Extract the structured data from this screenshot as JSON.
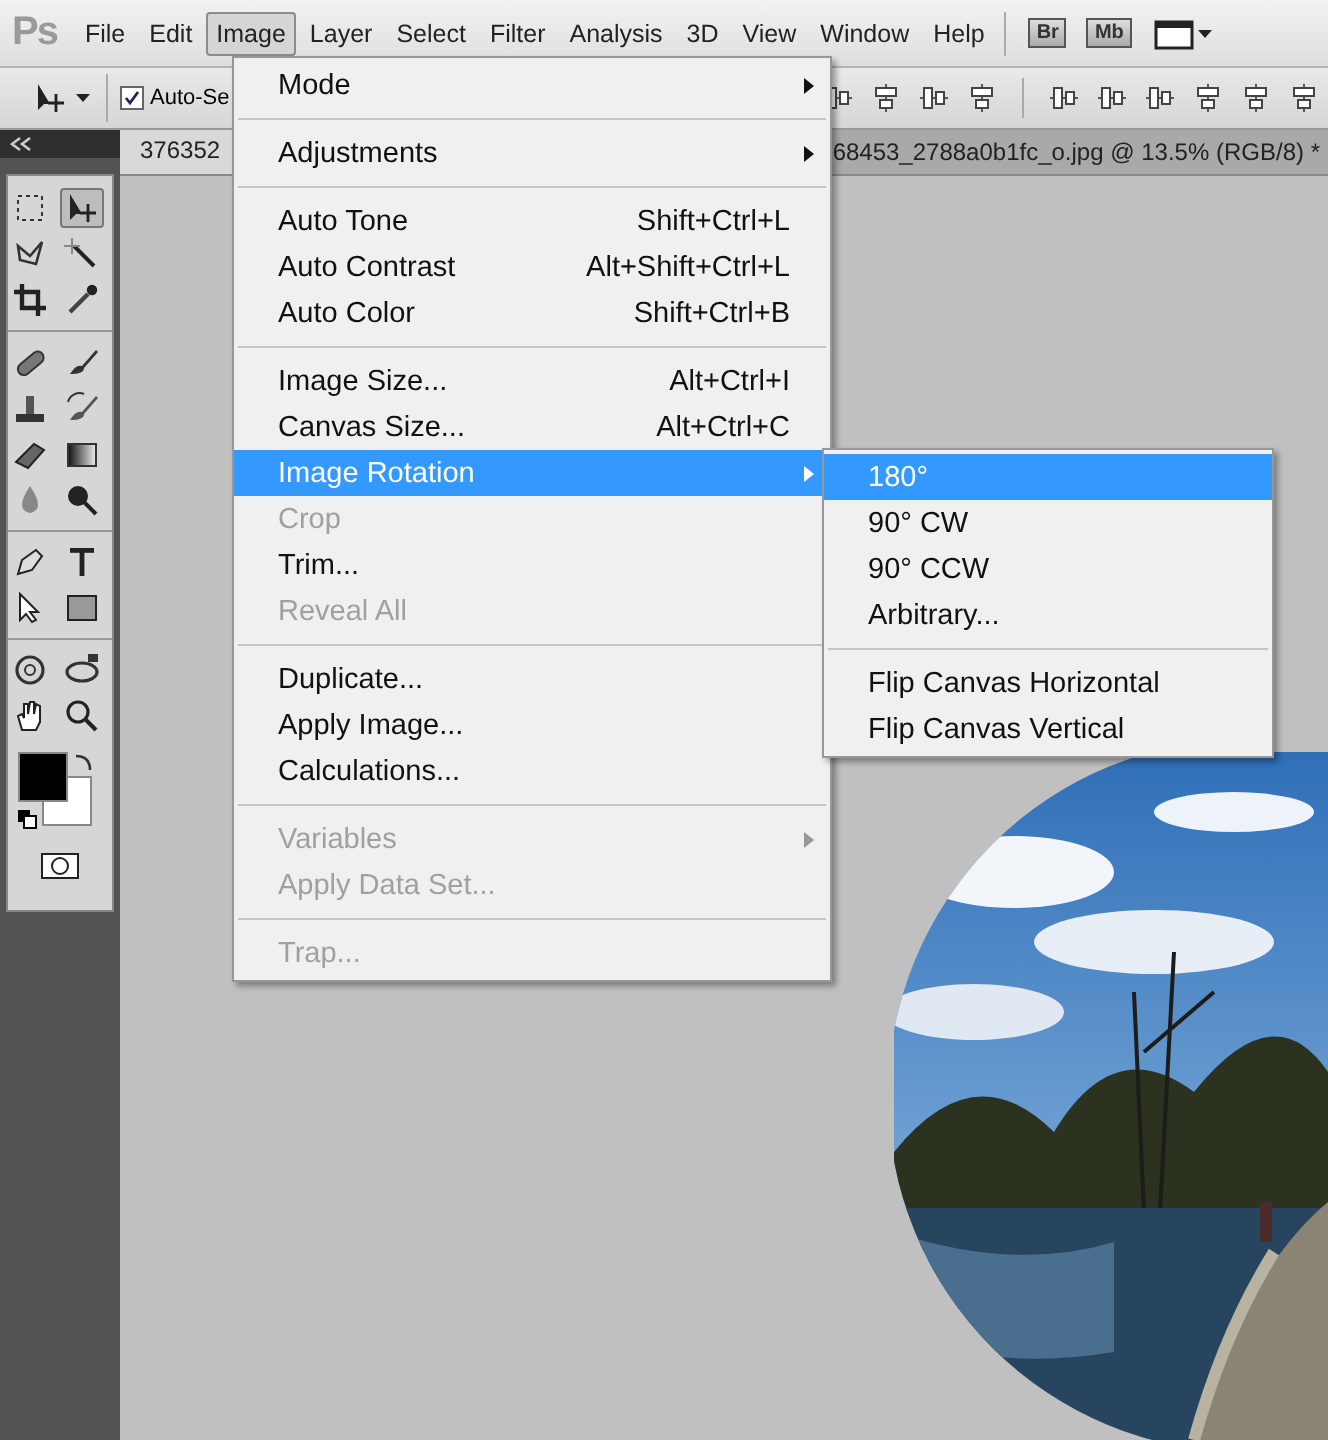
{
  "menu_bar": {
    "logo": "Ps",
    "items": [
      {
        "label": "File",
        "selected": false
      },
      {
        "label": "Edit",
        "selected": false
      },
      {
        "label": "Image",
        "selected": true
      },
      {
        "label": "Layer",
        "selected": false
      },
      {
        "label": "Select",
        "selected": false
      },
      {
        "label": "Filter",
        "selected": false
      },
      {
        "label": "Analysis",
        "selected": false
      },
      {
        "label": "3D",
        "selected": false
      },
      {
        "label": "View",
        "selected": false
      },
      {
        "label": "Window",
        "selected": false
      },
      {
        "label": "Help",
        "selected": false
      }
    ],
    "badges": [
      "Br",
      "Mb"
    ]
  },
  "options_bar": {
    "auto_select": {
      "label": "Auto-Se",
      "checked": true
    }
  },
  "document_tab": {
    "title_start": "376352",
    "title_end": "68453_2788a0b1fc_o.jpg @ 13.5% (RGB/8) *"
  },
  "toolbox": {
    "tools": [
      {
        "kind": "marquee",
        "selected": false
      },
      {
        "kind": "move",
        "selected": true
      },
      {
        "kind": "lasso",
        "selected": false
      },
      {
        "kind": "wand",
        "selected": false
      },
      {
        "kind": "crop",
        "selected": false
      },
      {
        "kind": "eyedropper",
        "selected": false
      },
      {
        "kind": "bandage",
        "selected": false
      },
      {
        "kind": "brush",
        "selected": false
      },
      {
        "kind": "stamp",
        "selected": false
      },
      {
        "kind": "history",
        "selected": false
      },
      {
        "kind": "eraser",
        "selected": false
      },
      {
        "kind": "gradient",
        "selected": false
      },
      {
        "kind": "drop",
        "selected": false
      },
      {
        "kind": "dodge",
        "selected": false
      },
      {
        "kind": "pen",
        "selected": false
      },
      {
        "kind": "type",
        "selected": false
      },
      {
        "kind": "path",
        "selected": false
      },
      {
        "kind": "shape",
        "selected": false
      },
      {
        "kind": "rotate3d",
        "selected": false
      },
      {
        "kind": "orbit",
        "selected": false
      },
      {
        "kind": "hand",
        "selected": false
      },
      {
        "kind": "zoom",
        "selected": false
      }
    ]
  },
  "image_menu": {
    "items": [
      {
        "kind": "item",
        "label": "Mode",
        "submenu": true,
        "disabled": false,
        "selected": false
      },
      {
        "kind": "separator"
      },
      {
        "kind": "item",
        "label": "Adjustments",
        "submenu": true,
        "disabled": false,
        "selected": false
      },
      {
        "kind": "separator"
      },
      {
        "kind": "item",
        "label": "Auto Tone",
        "shortcut": "Shift+Ctrl+L",
        "disabled": false,
        "selected": false
      },
      {
        "kind": "item",
        "label": "Auto Contrast",
        "shortcut": "Alt+Shift+Ctrl+L",
        "disabled": false,
        "selected": false
      },
      {
        "kind": "item",
        "label": "Auto Color",
        "shortcut": "Shift+Ctrl+B",
        "disabled": false,
        "selected": false
      },
      {
        "kind": "separator"
      },
      {
        "kind": "item",
        "label": "Image Size...",
        "shortcut": "Alt+Ctrl+I",
        "disabled": false,
        "selected": false
      },
      {
        "kind": "item",
        "label": "Canvas Size...",
        "shortcut": "Alt+Ctrl+C",
        "disabled": false,
        "selected": false
      },
      {
        "kind": "item",
        "label": "Image Rotation",
        "submenu": true,
        "disabled": false,
        "selected": true
      },
      {
        "kind": "item",
        "label": "Crop",
        "disabled": true,
        "selected": false
      },
      {
        "kind": "item",
        "label": "Trim...",
        "disabled": false,
        "selected": false
      },
      {
        "kind": "item",
        "label": "Reveal All",
        "disabled": true,
        "selected": false
      },
      {
        "kind": "separator"
      },
      {
        "kind": "item",
        "label": "Duplicate...",
        "disabled": false,
        "selected": false
      },
      {
        "kind": "item",
        "label": "Apply Image...",
        "disabled": false,
        "selected": false
      },
      {
        "kind": "item",
        "label": "Calculations...",
        "disabled": false,
        "selected": false
      },
      {
        "kind": "separator"
      },
      {
        "kind": "item",
        "label": "Variables",
        "submenu": true,
        "disabled": true,
        "selected": false
      },
      {
        "kind": "item",
        "label": "Apply Data Set...",
        "disabled": true,
        "selected": false
      },
      {
        "kind": "separator"
      },
      {
        "kind": "item",
        "label": "Trap...",
        "disabled": true,
        "selected": false
      }
    ]
  },
  "rotation_submenu": {
    "items": [
      {
        "kind": "item",
        "label": "180°",
        "selected": true
      },
      {
        "kind": "item",
        "label": "90° CW",
        "selected": false
      },
      {
        "kind": "item",
        "label": "90° CCW",
        "selected": false
      },
      {
        "kind": "item",
        "label": "Arbitrary...",
        "selected": false
      },
      {
        "kind": "separator"
      },
      {
        "kind": "item",
        "label": "Flip Canvas Horizontal",
        "selected": false
      },
      {
        "kind": "item",
        "label": "Flip Canvas Vertical",
        "selected": false
      }
    ]
  }
}
